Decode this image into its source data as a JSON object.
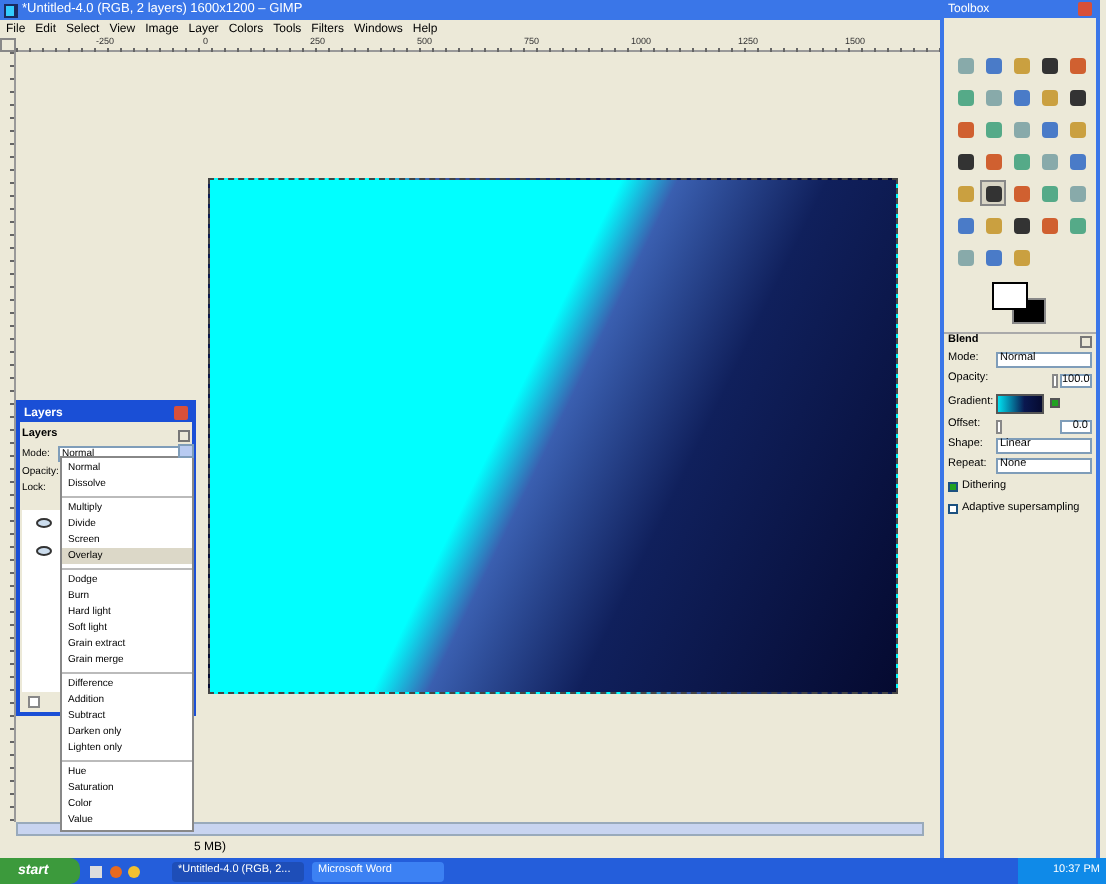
{
  "main_window": {
    "title": "*Untitled-4.0 (RGB, 2 layers) 1600x1200 – GIMP",
    "menu": [
      "File",
      "Edit",
      "Select",
      "View",
      "Image",
      "Layer",
      "Colors",
      "Tools",
      "Filters",
      "Windows",
      "Help"
    ],
    "ruler": [
      "-250",
      "0",
      "250",
      "500",
      "750",
      "1000",
      "1250",
      "1500"
    ],
    "status": "5 MB)"
  },
  "layers_dialog": {
    "title": "Layers",
    "header": "Layers",
    "mode_label": "Mode:",
    "mode_value": "Normal",
    "opacity_label": "Opacity:",
    "lock_label": "Lock:",
    "layers": [
      {
        "visible": true
      },
      {
        "visible": true
      }
    ],
    "mode_menu": [
      [
        {
          "label": "Normal",
          "selected": false
        },
        {
          "label": "Dissolve",
          "selected": false
        }
      ],
      [
        {
          "label": "Multiply",
          "selected": false
        },
        {
          "label": "Divide",
          "selected": false
        },
        {
          "label": "Screen",
          "selected": false
        },
        {
          "label": "Overlay",
          "selected": true
        }
      ],
      [
        {
          "label": "Dodge",
          "selected": false
        },
        {
          "label": "Burn",
          "selected": false
        },
        {
          "label": "Hard light",
          "selected": false
        },
        {
          "label": "Soft light",
          "selected": false
        },
        {
          "label": "Grain extract",
          "selected": false
        },
        {
          "label": "Grain merge",
          "selected": false
        }
      ],
      [
        {
          "label": "Difference",
          "selected": false
        },
        {
          "label": "Addition",
          "selected": false
        },
        {
          "label": "Subtract",
          "selected": false
        },
        {
          "label": "Darken only",
          "selected": false
        },
        {
          "label": "Lighten only",
          "selected": false
        }
      ],
      [
        {
          "label": "Hue",
          "selected": false
        },
        {
          "label": "Saturation",
          "selected": false
        },
        {
          "label": "Color",
          "selected": false
        },
        {
          "label": "Value",
          "selected": false
        }
      ]
    ]
  },
  "toolbox": {
    "title": "Toolbox",
    "tools": [
      {
        "selected": false
      },
      {
        "selected": false
      },
      {
        "selected": false
      },
      {
        "selected": false
      },
      {
        "selected": false
      },
      {
        "selected": false
      },
      {
        "selected": false
      },
      {
        "selected": false
      },
      {
        "selected": false
      },
      {
        "selected": false
      },
      {
        "selected": false
      },
      {
        "selected": false
      },
      {
        "selected": false
      },
      {
        "selected": false
      },
      {
        "selected": false
      },
      {
        "selected": false
      },
      {
        "selected": false
      },
      {
        "selected": false
      },
      {
        "selected": false
      },
      {
        "selected": false
      },
      {
        "selected": false
      },
      {
        "selected": true
      },
      {
        "selected": false
      },
      {
        "selected": false
      },
      {
        "selected": false
      },
      {
        "selected": false
      },
      {
        "selected": false
      },
      {
        "selected": false
      },
      {
        "selected": false
      },
      {
        "selected": false
      },
      {
        "selected": false
      },
      {
        "selected": false
      },
      {
        "selected": false
      }
    ],
    "options": {
      "title": "Blend",
      "mode_label": "Mode:",
      "mode_value": "Normal",
      "opacity": {
        "label": "Opacity:",
        "value": "100.0",
        "level": 1
      },
      "gradient_label": "Gradient:",
      "gradient_reversed": true,
      "offset": {
        "label": "Offset:",
        "value": "0.0",
        "level": 0
      },
      "shape_label": "Shape:",
      "shape_value": "Linear",
      "repeat_label": "Repeat:",
      "repeat_value": "None",
      "checks": [
        {
          "label": "Dithering",
          "checked": true
        },
        {
          "label": "Adaptive supersampling",
          "checked": false
        }
      ]
    }
  },
  "taskbar": {
    "start": "start",
    "tasks": [
      {
        "label": "*Untitled-4.0 (RGB, 2...",
        "selected": true
      },
      {
        "label": "Microsoft Word",
        "selected": false
      }
    ],
    "clock": "10:37 PM"
  }
}
